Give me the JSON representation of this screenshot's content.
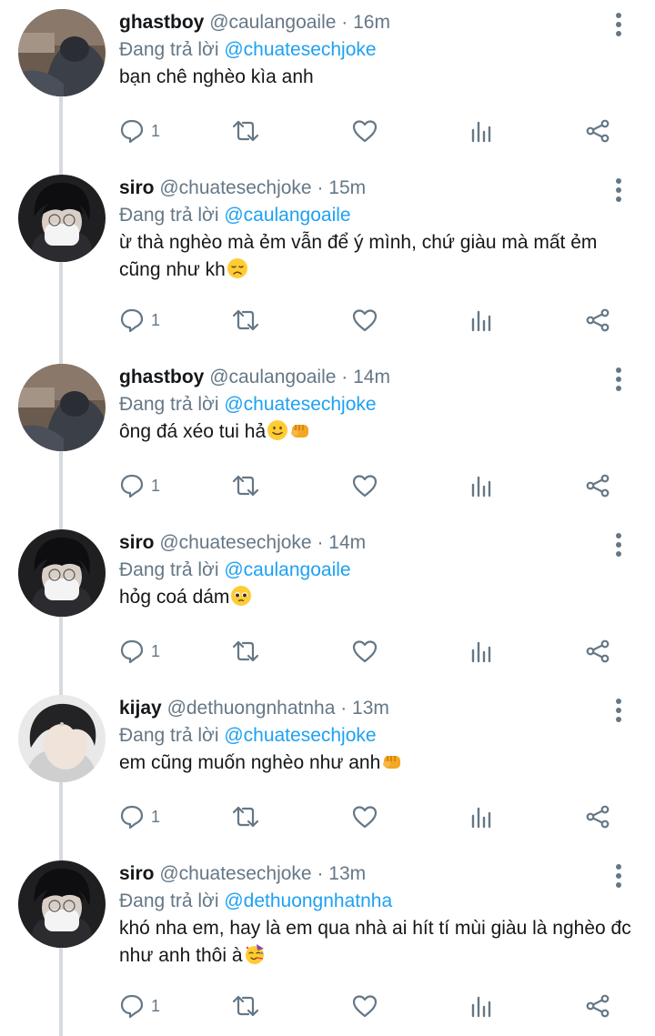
{
  "colors": {
    "link": "#1da1f2",
    "secondary": "#657786",
    "thread_line": "#d7dbdf"
  },
  "reply_prefix": "Đang trả lời",
  "tweets": [
    {
      "name": "ghastboy",
      "handle": "@caulangoaile",
      "time": "· 16m",
      "reply_to": "@chuatesechjoke",
      "text": "bạn chê nghèo kìa anh",
      "emoji": [],
      "reply_count": "1",
      "avatar": "ghastboy-avatar"
    },
    {
      "name": "siro",
      "handle": "@chuatesechjoke",
      "time": "· 15m",
      "reply_to": "@caulangoaile",
      "text": "ừ thà nghèo mà ẻm vẫn để ý mình, chứ giàu mà mất ẻm cũng như kh",
      "emoji": [
        "disappointed-face"
      ],
      "reply_count": "1",
      "avatar": "siro-avatar"
    },
    {
      "name": "ghastboy",
      "handle": "@caulangoaile",
      "time": "· 14m",
      "reply_to": "@chuatesechjoke",
      "text": "ông đá xéo tui hả",
      "emoji": [
        "slightly-smiling-face",
        "fist-bump"
      ],
      "reply_count": "1",
      "avatar": "ghastboy-avatar"
    },
    {
      "name": "siro",
      "handle": "@chuatesechjoke",
      "time": "· 14m",
      "reply_to": "@caulangoaile",
      "text": "hỏg coá dám",
      "emoji": [
        "pleading-face"
      ],
      "reply_count": "1",
      "avatar": "siro-avatar"
    },
    {
      "name": "kijay",
      "handle": "@dethuongnhatnha",
      "time": "· 13m",
      "reply_to": "@chuatesechjoke",
      "text": "em cũng muốn nghèo như anh",
      "emoji": [
        "fist-bump"
      ],
      "reply_count": "1",
      "avatar": "kijay-avatar"
    },
    {
      "name": "siro",
      "handle": "@chuatesechjoke",
      "time": "· 13m",
      "reply_to": "@dethuongnhatnha",
      "text": "khó nha em, hay là em qua nhà ai hít tí mùi giàu là nghèo đc như anh thôi à",
      "emoji": [
        "partying-face"
      ],
      "reply_count": "1",
      "avatar": "siro-avatar"
    }
  ]
}
